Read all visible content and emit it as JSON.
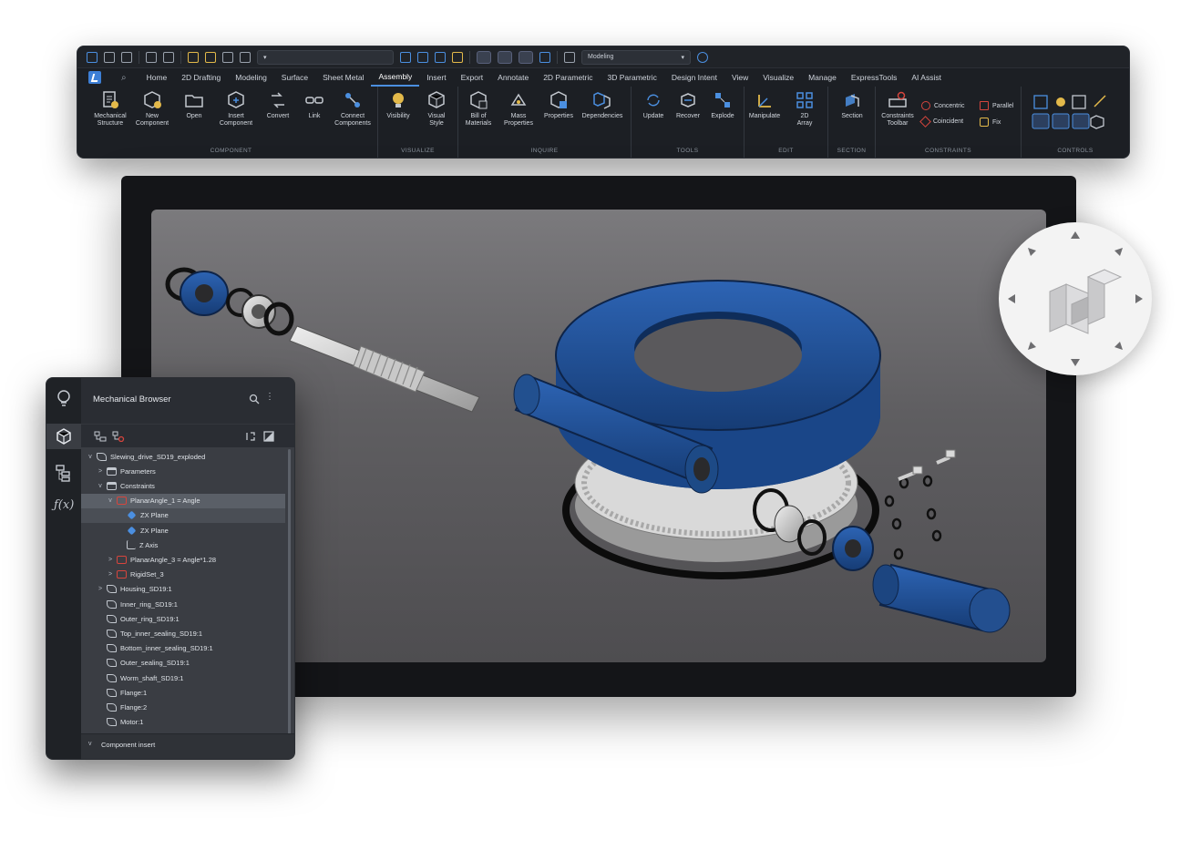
{
  "ribbon": {
    "workspace": "Modeling",
    "tabs": [
      "Home",
      "2D Drafting",
      "Modeling",
      "Surface",
      "Sheet Metal",
      "Assembly",
      "Insert",
      "Export",
      "Annotate",
      "2D Parametric",
      "3D Parametric",
      "Design Intent",
      "View",
      "Visualize",
      "Manage",
      "ExpressTools",
      "AI Assist"
    ],
    "active_tab": "Assembly",
    "panels": {
      "component": {
        "title": "COMPONENT",
        "buttons": [
          "Mechanical\nStructure",
          "New\nComponent",
          "Open",
          "Insert\nComponent",
          "Convert",
          "Link",
          "Connect\nComponents"
        ]
      },
      "visualize": {
        "title": "VISUALIZE",
        "buttons": [
          "Visibility",
          "Visual\nStyle"
        ]
      },
      "inquire": {
        "title": "INQUIRE",
        "buttons": [
          "Bill of\nMaterials",
          "Mass\nProperties",
          "Properties",
          "Dependencies"
        ]
      },
      "tools": {
        "title": "TOOLS",
        "buttons": [
          "Update",
          "Recover",
          "Explode"
        ]
      },
      "edit": {
        "title": "EDIT",
        "buttons": [
          "Manipulate",
          "2D\nArray"
        ]
      },
      "section": {
        "title": "SECTION",
        "buttons": [
          "Section"
        ]
      },
      "constraints": {
        "title": "CONSTRAINTS",
        "buttons": [
          "Constraints\nToolbar"
        ],
        "small": [
          "Concentric",
          "Coincident",
          "Parallel",
          "Fix"
        ]
      },
      "controls": {
        "title": "CONTROLS"
      }
    }
  },
  "browser": {
    "title": "Mechanical Browser",
    "rail_icons": [
      "lightbulb-icon",
      "cube-icon",
      "tree-icon",
      "function-icon"
    ],
    "tree": [
      {
        "label": "Slewing_drive_SD19_exploded",
        "level": 0,
        "chev": "v",
        "icon": "assembly"
      },
      {
        "label": "Parameters",
        "level": 1,
        "chev": ">",
        "icon": "folder"
      },
      {
        "label": "Constraints",
        "level": 1,
        "chev": "v",
        "icon": "folder"
      },
      {
        "label": "PlanarAngle_1 = Angle",
        "level": 2,
        "chev": "v",
        "icon": "cons",
        "state": "sel"
      },
      {
        "label": "ZX Plane",
        "level": 3,
        "chev": "",
        "icon": "plane",
        "state": "hl"
      },
      {
        "label": "ZX Plane",
        "level": 3,
        "chev": "",
        "icon": "plane"
      },
      {
        "label": "Z Axis",
        "level": 3,
        "chev": "",
        "icon": "axis"
      },
      {
        "label": "PlanarAngle_3 = Angle*1.28",
        "level": 2,
        "chev": ">",
        "icon": "cons"
      },
      {
        "label": "RigidSet_3",
        "level": 2,
        "chev": ">",
        "icon": "cons"
      },
      {
        "label": "Housing_SD19:1",
        "level": 1,
        "chev": ">",
        "icon": "part"
      },
      {
        "label": "Inner_ring_SD19:1",
        "level": 1,
        "chev": "",
        "icon": "part"
      },
      {
        "label": "Outer_ring_SD19:1",
        "level": 1,
        "chev": "",
        "icon": "part"
      },
      {
        "label": "Top_inner_sealing_SD19:1",
        "level": 1,
        "chev": "",
        "icon": "part"
      },
      {
        "label": "Bottom_inner_sealing_SD19:1",
        "level": 1,
        "chev": "",
        "icon": "part"
      },
      {
        "label": "Outer_sealing_SD19:1",
        "level": 1,
        "chev": "",
        "icon": "part"
      },
      {
        "label": "Worm_shaft_SD19:1",
        "level": 1,
        "chev": "",
        "icon": "part"
      },
      {
        "label": "Flange:1",
        "level": 1,
        "chev": "",
        "icon": "part"
      },
      {
        "label": "Flange:2",
        "level": 1,
        "chev": "",
        "icon": "part"
      },
      {
        "label": "Motor:1",
        "level": 1,
        "chev": "",
        "icon": "part"
      }
    ],
    "section_label": "Component insert"
  },
  "colors": {
    "accent": "#4b8fe0",
    "part_blue": "#1f4f96",
    "constraint_red": "#d6453d",
    "viewport_bg": "#6b6a6d"
  }
}
